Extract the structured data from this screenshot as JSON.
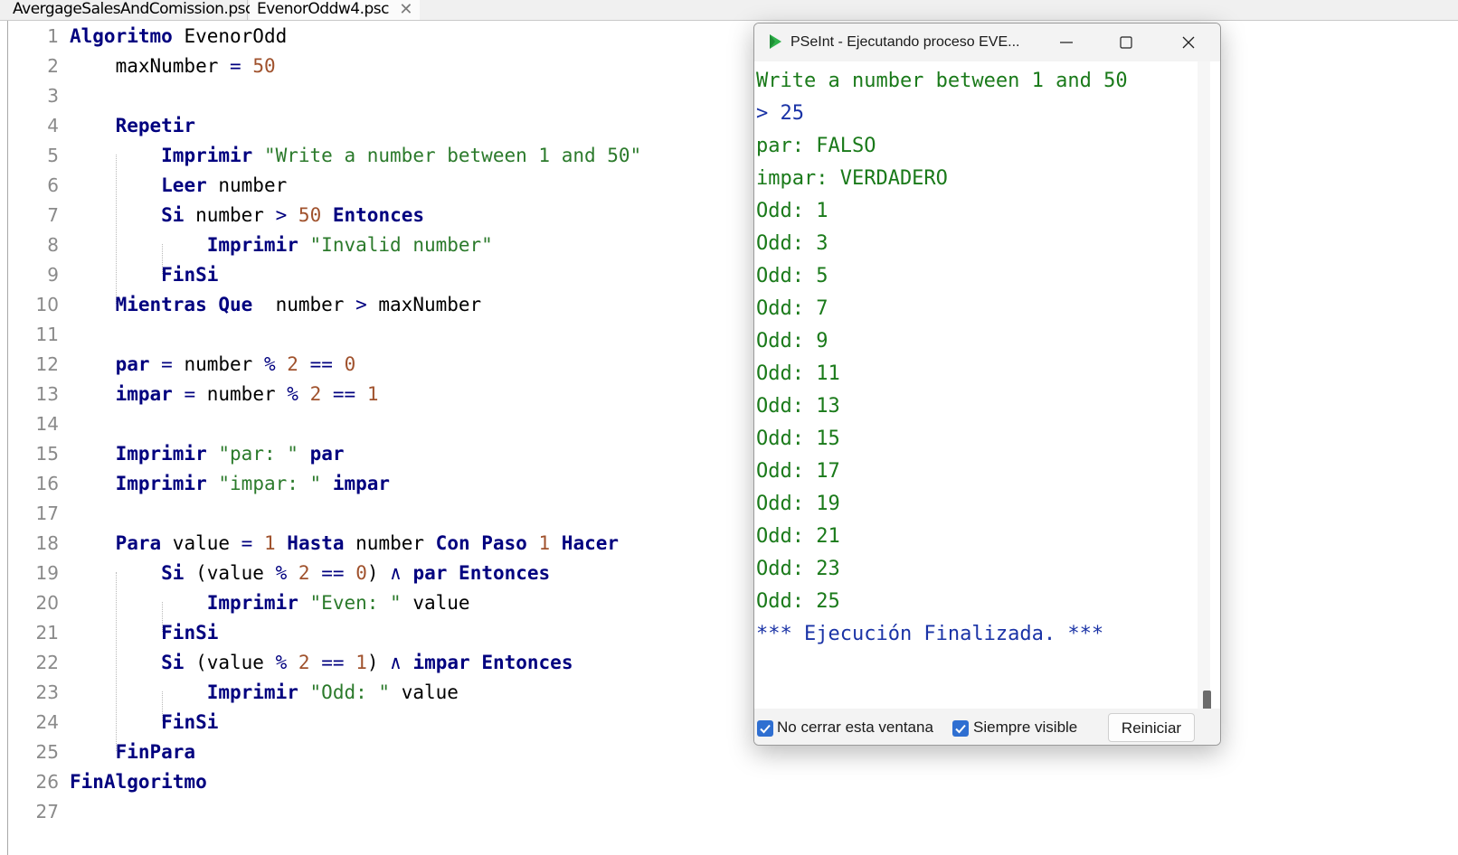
{
  "tabs": [
    {
      "label": "AvergageSalesAndComission.psc"
    },
    {
      "label": "EvenorOddw4.psc",
      "close": "✕"
    }
  ],
  "code": {
    "line_numbers": [
      "1",
      "2",
      "3",
      "4",
      "5",
      "6",
      "7",
      "8",
      "9",
      "10",
      "11",
      "12",
      "13",
      "14",
      "15",
      "16",
      "17",
      "18",
      "19",
      "20",
      "21",
      "22",
      "23",
      "24",
      "25",
      "26",
      "27"
    ]
  },
  "run_window": {
    "title": "PSeInt - Ejecutando proceso EVE...",
    "console": [
      "Write a number between 1 and 50",
      "> 25",
      "par: FALSO",
      "impar: VERDADERO",
      "Odd: 1",
      "Odd: 3",
      "Odd: 5",
      "Odd: 7",
      "Odd: 9",
      "Odd: 11",
      "Odd: 13",
      "Odd: 15",
      "Odd: 17",
      "Odd: 19",
      "Odd: 21",
      "Odd: 23",
      "Odd: 25",
      "*** Ejecución Finalizada. ***"
    ],
    "no_cerrar_label": "No cerrar esta ventana",
    "no_cerrar_checked": true,
    "siempre_visible_label": "Siempre visible",
    "siempre_visible_checked": true,
    "reiniciar_label": "Reiniciar"
  },
  "colors": {
    "keyword": "#00007f",
    "number": "#a0522d",
    "string": "#2b7a2b",
    "console_output": "#1a7a1a",
    "console_info": "#1a33a6",
    "checkbox": "#2f6fd1"
  }
}
